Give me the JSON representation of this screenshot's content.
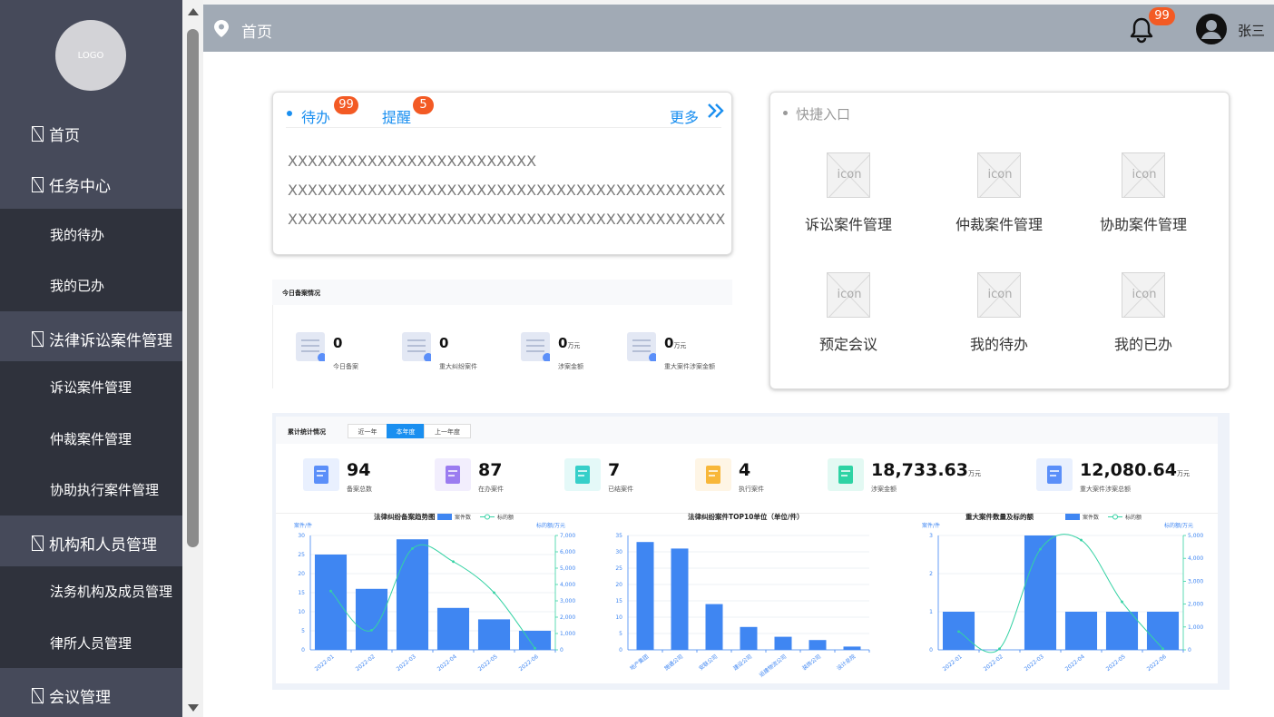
{
  "sidebar": {
    "logo": "LOGO",
    "items": [
      {
        "label": "首页"
      },
      {
        "label": "任务中心",
        "children": [
          "我的待办",
          "我的已办"
        ]
      },
      {
        "label": "法律诉讼案件管理",
        "children": [
          "诉讼案件管理",
          "仲裁案件管理",
          "协助执行案件管理"
        ]
      },
      {
        "label": "机构和人员管理",
        "children": [
          "法务机构及成员管理",
          "律所人员管理"
        ]
      },
      {
        "label": "会议管理"
      }
    ]
  },
  "header": {
    "title": "首页",
    "notification_count": "99",
    "user_name": "张三"
  },
  "todo_card": {
    "tab_todo": "待办",
    "tab_todo_badge": "99",
    "tab_remind": "提醒",
    "tab_remind_badge": "5",
    "more": "更多",
    "lines": [
      "XXXXXXXXXXXXXXXXXXXXXXXXX",
      "XXXXXXXXXXXXXXXXXXXXXXXXXXXXXXXXXXXXXXXXXXXX",
      "XXXXXXXXXXXXXXXXXXXXXXXXXXXXXXXXXXXXXXXXXXXX"
    ]
  },
  "quick_entry": {
    "title": "快捷入口",
    "icon_text": "icon",
    "items": [
      "诉讼案件管理",
      "仲裁案件管理",
      "协助案件管理",
      "预定会议",
      "我的待办",
      "我的已办"
    ]
  },
  "today": {
    "title": "今日备案情况",
    "stats": [
      {
        "value": "0",
        "unit": "",
        "label": "今日备案"
      },
      {
        "value": "0",
        "unit": "",
        "label": "重大纠纷案件"
      },
      {
        "value": "0",
        "unit": "万元",
        "label": "涉案金额"
      },
      {
        "value": "0",
        "unit": "万元",
        "label": "重大案件涉案金额"
      }
    ]
  },
  "cumulative": {
    "title": "累计统计情况",
    "tabs": [
      "近一年",
      "本年度",
      "上一年度"
    ],
    "active_tab": 1,
    "stats": [
      {
        "value": "94",
        "unit": "",
        "label": "备案总数",
        "color": "#5b8ff9"
      },
      {
        "value": "87",
        "unit": "",
        "label": "在办案件",
        "color": "#9b7cf0"
      },
      {
        "value": "7",
        "unit": "",
        "label": "已结案件",
        "color": "#36cfc9"
      },
      {
        "value": "4",
        "unit": "",
        "label": "执行案件",
        "color": "#f8b739"
      },
      {
        "value": "18,733.63",
        "unit": "万元",
        "label": "涉案金额",
        "color": "#2ed3a4"
      },
      {
        "value": "12,080.64",
        "unit": "万元",
        "label": "重大案件涉案总额",
        "color": "#5b8ff9"
      }
    ]
  },
  "colors": {
    "bar": "#3f86f2",
    "line": "#35d2a4",
    "accent": "#1a8ff0",
    "badge": "#f35a24"
  },
  "chart_data": [
    {
      "type": "bar",
      "title": "法律纠纷备案趋势图",
      "ylabel": "案件/件",
      "y2label": "标的额/万元",
      "legend": [
        "案件数",
        "标的额"
      ],
      "categories": [
        "2022-01",
        "2022-02",
        "2022-03",
        "2022-04",
        "2022-05",
        "2022-06"
      ],
      "ylim": [
        0,
        30
      ],
      "y2lim": [
        0,
        7000
      ],
      "yticks": [
        0,
        5,
        10,
        15,
        20,
        25,
        30
      ],
      "y2ticks": [
        "0",
        "1,000",
        "2,000",
        "3,000",
        "4,000",
        "5,000",
        "6,000",
        "7,000"
      ],
      "series": [
        {
          "name": "案件数",
          "type": "bar",
          "values": [
            25,
            16,
            29,
            11,
            8,
            5
          ]
        },
        {
          "name": "标的额",
          "type": "line",
          "axis": "y2",
          "values": [
            3600,
            1200,
            6200,
            5400,
            3500,
            100
          ]
        }
      ]
    },
    {
      "type": "bar",
      "title": "法律纠纷案件TOP10单位（单位/件）",
      "categories": [
        "地产集团",
        "施通公司",
        "安联公司",
        "建设公司",
        "运建物流公司",
        "装饰公司",
        "设计总院"
      ],
      "ylim": [
        0,
        35
      ],
      "yticks": [
        0,
        5,
        10,
        15,
        20,
        25,
        30,
        35
      ],
      "series": [
        {
          "name": "案件数",
          "values": [
            33,
            31,
            14,
            7,
            4,
            3,
            1
          ]
        }
      ]
    },
    {
      "type": "bar",
      "title": "重大案件数量及标的额",
      "ylabel": "案件/件",
      "y2label": "标的额/万元",
      "legend": [
        "案件数",
        "标的额"
      ],
      "categories": [
        "2022-01",
        "2022-02",
        "2022-03",
        "2022-04",
        "2022-05",
        "2022-06"
      ],
      "ylim": [
        0,
        3
      ],
      "y2lim": [
        0,
        5000
      ],
      "yticks": [
        0,
        1,
        2,
        3
      ],
      "y2ticks": [
        "0",
        "1,000",
        "2,000",
        "3,000",
        "4,000",
        "5,000"
      ],
      "series": [
        {
          "name": "案件数",
          "type": "bar",
          "values": [
            1,
            0,
            3,
            1,
            1,
            1
          ]
        },
        {
          "name": "标的额",
          "type": "line",
          "axis": "y2",
          "values": [
            800,
            50,
            4400,
            4800,
            2100,
            50
          ]
        }
      ]
    }
  ]
}
